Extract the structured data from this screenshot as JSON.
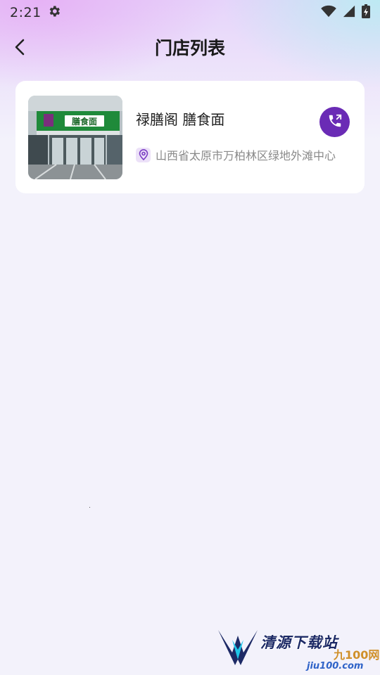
{
  "status_bar": {
    "time": "2:21",
    "icons": [
      "settings-icon",
      "wifi-icon",
      "signal-icon",
      "battery-charging-icon"
    ]
  },
  "nav": {
    "back_icon": "chevron-left-icon",
    "title": "门店列表"
  },
  "stores": [
    {
      "name": "禄膳阁 膳食面",
      "image_sign_text": "膳食面",
      "address": "山西省太原市万柏林区绿地外滩中心",
      "call_icon": "phone-call-icon",
      "location_icon": "location-pin-icon"
    }
  ],
  "watermark": {
    "title": "清源下载站",
    "site_text": "九100网",
    "site_url": "jiu100.com"
  },
  "colors": {
    "accent": "#6a2bb5",
    "card_bg": "#ffffff",
    "page_bg": "#f3f2fb",
    "address_text": "#8a8a8a"
  }
}
